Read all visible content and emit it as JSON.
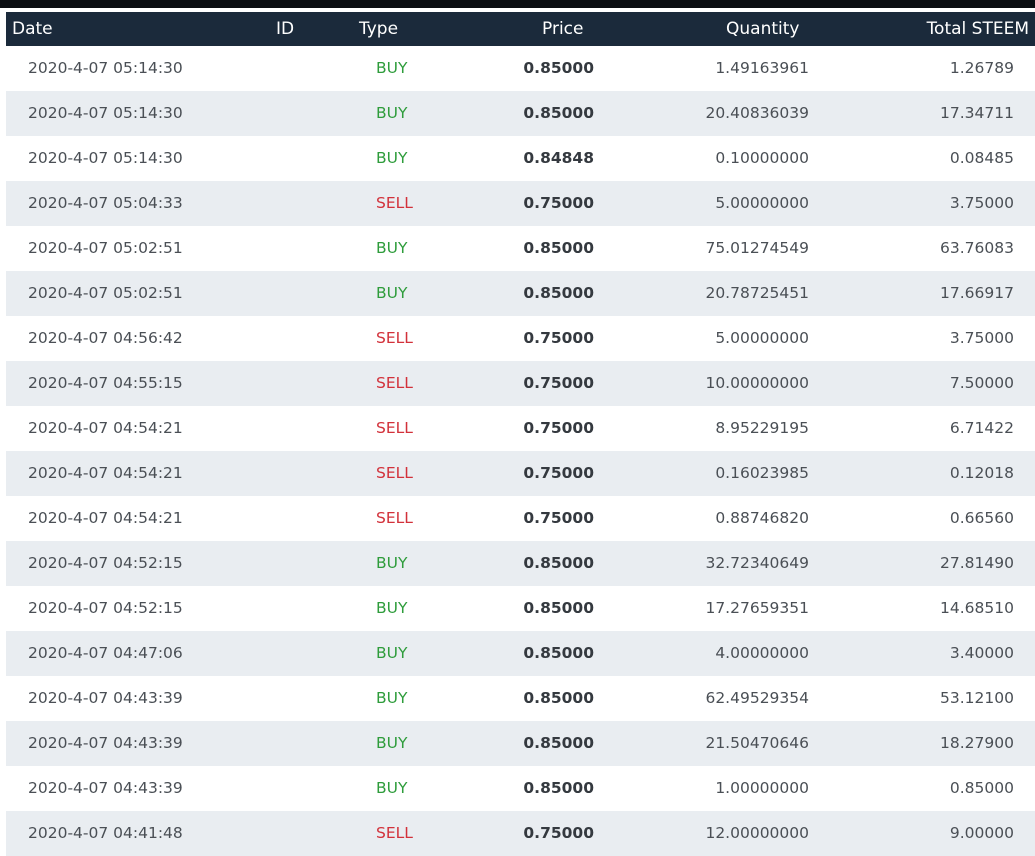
{
  "table": {
    "headers": {
      "date": "Date",
      "id": "ID",
      "type": "Type",
      "price": "Price",
      "quantity": "Quantity",
      "total": "Total STEEM"
    },
    "rows": [
      {
        "date": "2020-4-07 05:14:30",
        "type": "BUY",
        "price": "0.85000",
        "quantity": "1.49163961",
        "total": "1.26789"
      },
      {
        "date": "2020-4-07 05:14:30",
        "type": "BUY",
        "price": "0.85000",
        "quantity": "20.40836039",
        "total": "17.34711"
      },
      {
        "date": "2020-4-07 05:14:30",
        "type": "BUY",
        "price": "0.84848",
        "quantity": "0.10000000",
        "total": "0.08485"
      },
      {
        "date": "2020-4-07 05:04:33",
        "type": "SELL",
        "price": "0.75000",
        "quantity": "5.00000000",
        "total": "3.75000"
      },
      {
        "date": "2020-4-07 05:02:51",
        "type": "BUY",
        "price": "0.85000",
        "quantity": "75.01274549",
        "total": "63.76083"
      },
      {
        "date": "2020-4-07 05:02:51",
        "type": "BUY",
        "price": "0.85000",
        "quantity": "20.78725451",
        "total": "17.66917"
      },
      {
        "date": "2020-4-07 04:56:42",
        "type": "SELL",
        "price": "0.75000",
        "quantity": "5.00000000",
        "total": "3.75000"
      },
      {
        "date": "2020-4-07 04:55:15",
        "type": "SELL",
        "price": "0.75000",
        "quantity": "10.00000000",
        "total": "7.50000"
      },
      {
        "date": "2020-4-07 04:54:21",
        "type": "SELL",
        "price": "0.75000",
        "quantity": "8.95229195",
        "total": "6.71422"
      },
      {
        "date": "2020-4-07 04:54:21",
        "type": "SELL",
        "price": "0.75000",
        "quantity": "0.16023985",
        "total": "0.12018"
      },
      {
        "date": "2020-4-07 04:54:21",
        "type": "SELL",
        "price": "0.75000",
        "quantity": "0.88746820",
        "total": "0.66560"
      },
      {
        "date": "2020-4-07 04:52:15",
        "type": "BUY",
        "price": "0.85000",
        "quantity": "32.72340649",
        "total": "27.81490"
      },
      {
        "date": "2020-4-07 04:52:15",
        "type": "BUY",
        "price": "0.85000",
        "quantity": "17.27659351",
        "total": "14.68510"
      },
      {
        "date": "2020-4-07 04:47:06",
        "type": "BUY",
        "price": "0.85000",
        "quantity": "4.00000000",
        "total": "3.40000"
      },
      {
        "date": "2020-4-07 04:43:39",
        "type": "BUY",
        "price": "0.85000",
        "quantity": "62.49529354",
        "total": "53.12100"
      },
      {
        "date": "2020-4-07 04:43:39",
        "type": "BUY",
        "price": "0.85000",
        "quantity": "21.50470646",
        "total": "18.27900"
      },
      {
        "date": "2020-4-07 04:43:39",
        "type": "BUY",
        "price": "0.85000",
        "quantity": "1.00000000",
        "total": "0.85000"
      },
      {
        "date": "2020-4-07 04:41:48",
        "type": "SELL",
        "price": "0.75000",
        "quantity": "12.00000000",
        "total": "9.00000"
      }
    ]
  },
  "colors": {
    "header_bg": "#1b2a3b",
    "buy": "#2e9c3b",
    "sell": "#d2313a",
    "row_alt": "#e9edf1"
  }
}
